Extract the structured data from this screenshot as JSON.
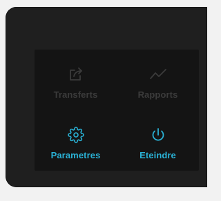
{
  "colors": {
    "accent": "#2ab2d6",
    "disabled": "#3b3b3b",
    "panel": "#141414",
    "device": "#1f1f1f"
  },
  "menu": {
    "items": [
      {
        "label": "Transferts",
        "icon": "share-export-icon",
        "state": "disabled"
      },
      {
        "label": "Rapports",
        "icon": "line-chart-icon",
        "state": "disabled"
      },
      {
        "label": "Parametres",
        "icon": "gear-icon",
        "state": "active"
      },
      {
        "label": "Eteindre",
        "icon": "power-icon",
        "state": "active"
      }
    ]
  }
}
